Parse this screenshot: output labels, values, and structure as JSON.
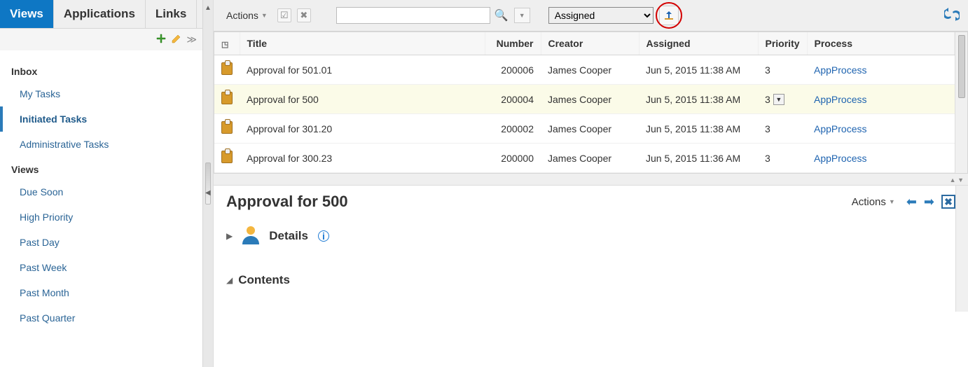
{
  "sidebar": {
    "tabs": [
      "Views",
      "Applications",
      "Links"
    ],
    "active_tab_index": 0,
    "inbox_heading": "Inbox",
    "inbox_items": [
      "My Tasks",
      "Initiated Tasks",
      "Administrative Tasks"
    ],
    "inbox_selected_index": 1,
    "views_heading": "Views",
    "views_items": [
      "Due Soon",
      "High Priority",
      "Past Day",
      "Past Week",
      "Past Month",
      "Past Quarter"
    ]
  },
  "toolbar": {
    "actions_label": "Actions",
    "search_placeholder": "",
    "state_options": [
      "Assigned"
    ],
    "state_selected": "Assigned"
  },
  "table": {
    "headers": {
      "title": "Title",
      "number": "Number",
      "creator": "Creator",
      "assigned": "Assigned",
      "priority": "Priority",
      "process": "Process"
    },
    "rows": [
      {
        "title": "Approval for 501.01",
        "number": "200006",
        "creator": "James Cooper",
        "assigned": "Jun 5, 2015 11:38 AM",
        "priority": "3",
        "process": "AppProcess"
      },
      {
        "title": "Approval for 500",
        "number": "200004",
        "creator": "James Cooper",
        "assigned": "Jun 5, 2015 11:38 AM",
        "priority": "3",
        "process": "AppProcess"
      },
      {
        "title": "Approval for 301.20",
        "number": "200002",
        "creator": "James Cooper",
        "assigned": "Jun 5, 2015 11:38 AM",
        "priority": "3",
        "process": "AppProcess"
      },
      {
        "title": "Approval for 300.23",
        "number": "200000",
        "creator": "James Cooper",
        "assigned": "Jun 5, 2015 11:36 AM",
        "priority": "3",
        "process": "AppProcess"
      }
    ],
    "selected_row_index": 1
  },
  "detail": {
    "title": "Approval for 500",
    "actions_label": "Actions",
    "details_label": "Details",
    "contents_label": "Contents"
  }
}
